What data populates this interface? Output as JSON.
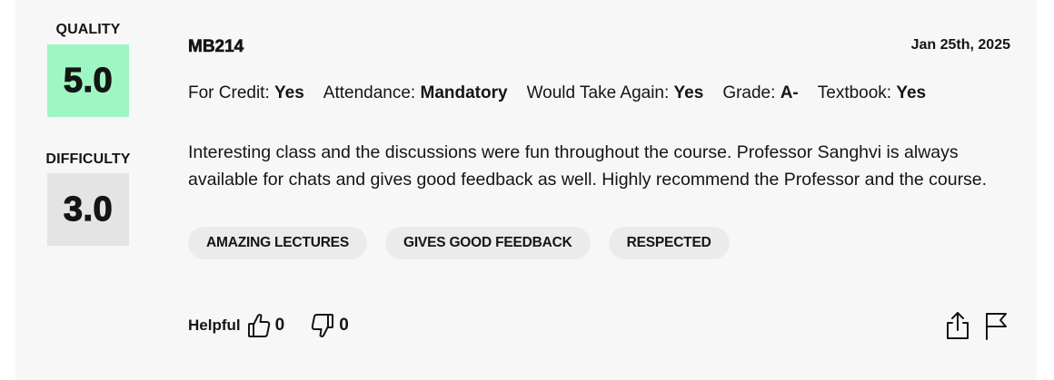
{
  "rating": {
    "quality_label": "QUALITY",
    "quality_value": "5.0",
    "quality_color": "#9ef7c3",
    "difficulty_label": "DIFFICULTY",
    "difficulty_value": "3.0",
    "difficulty_color": "#e4e4e4"
  },
  "review": {
    "course": "MB214",
    "date": "Jan 25th, 2025",
    "meta": [
      {
        "label": "For Credit: ",
        "value": "Yes"
      },
      {
        "label": "Attendance: ",
        "value": "Mandatory"
      },
      {
        "label": "Would Take Again: ",
        "value": "Yes"
      },
      {
        "label": "Grade: ",
        "value": "A-"
      },
      {
        "label": "Textbook: ",
        "value": "Yes"
      }
    ],
    "comment": "Interesting class and the discussions were fun throughout the course. Professor Sanghvi is always available for chats and gives good feedback as well. Highly recommend the Professor and the course.",
    "tags": [
      "AMAZING LECTURES",
      "GIVES GOOD FEEDBACK",
      "RESPECTED"
    ]
  },
  "footer": {
    "helpful_label": "Helpful",
    "thumbs_up_count": "0",
    "thumbs_down_count": "0",
    "icons": [
      "thumbs-up-icon",
      "thumbs-down-icon",
      "share-icon",
      "flag-icon"
    ]
  }
}
